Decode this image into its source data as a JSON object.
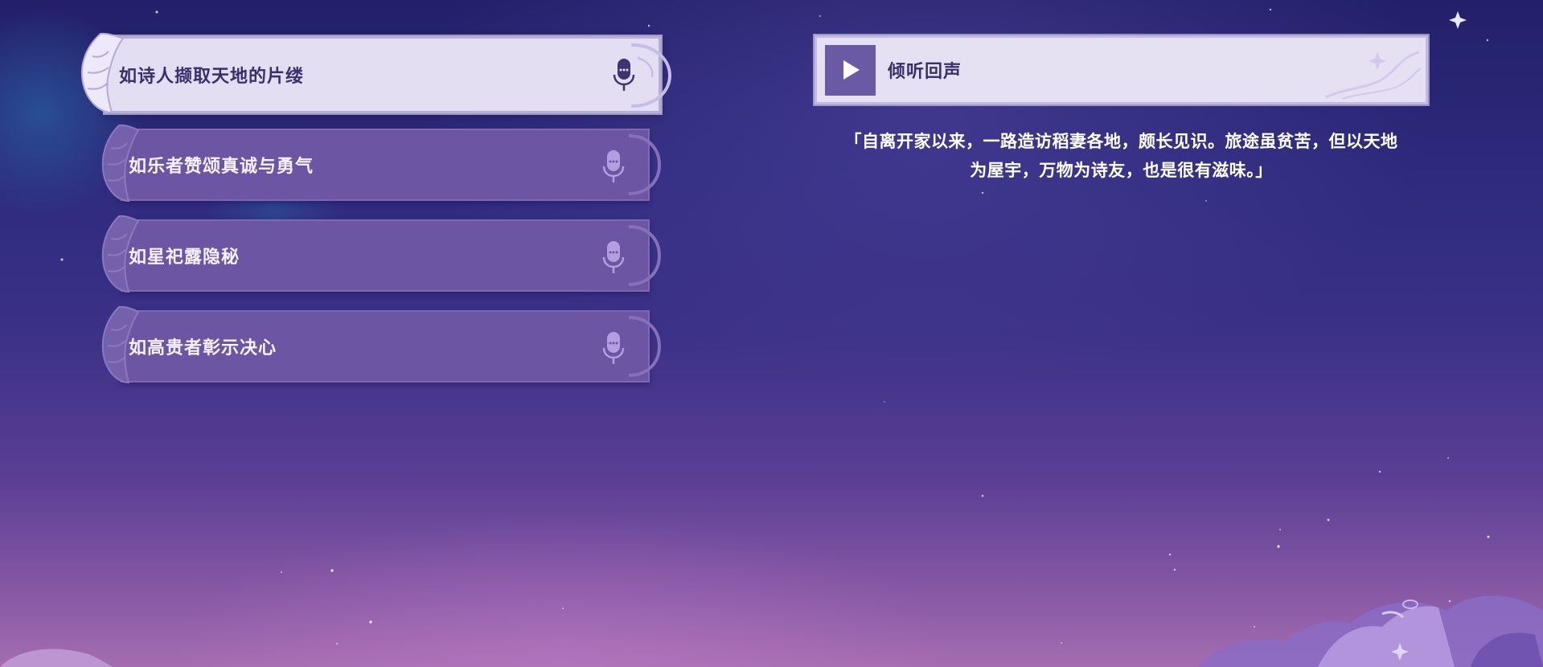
{
  "options": [
    {
      "label": "如诗人撷取天地的片缕",
      "state": "selected",
      "icon": "microphone-icon"
    },
    {
      "label": "如乐者赞颂真诚与勇气",
      "state": "default",
      "icon": "microphone-icon"
    },
    {
      "label": "如星祀露隐秘",
      "state": "default",
      "icon": "microphone-icon"
    },
    {
      "label": "如高贵者彰示决心",
      "state": "default",
      "icon": "microphone-icon"
    }
  ],
  "listen": {
    "label": "倾听回声",
    "icon": "play-icon"
  },
  "quote": {
    "line1": "「自离开家以来，一路造访稻妻各地，颇长见识。旅途虽贫苦，但以天地",
    "line2": "为屋宇，万物为诗友，也是很有滋味。」"
  },
  "colors": {
    "accent": "#6a5aa6",
    "selected_bg": "#e4def2",
    "option_bg": "#6c55a3",
    "text_dark": "#3b2f6b"
  }
}
